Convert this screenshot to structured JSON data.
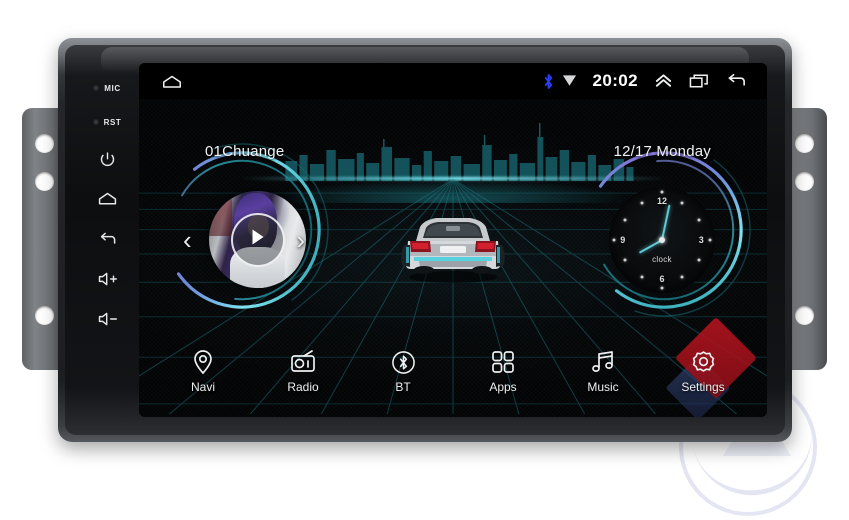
{
  "device": {
    "hard_keys": [
      {
        "name": "mic",
        "label": "MIC",
        "type": "port"
      },
      {
        "name": "reset",
        "label": "RST",
        "type": "port"
      },
      {
        "name": "power",
        "label": "",
        "type": "icon",
        "icon": "power-icon"
      },
      {
        "name": "home",
        "label": "",
        "type": "icon",
        "icon": "home-icon"
      },
      {
        "name": "back",
        "label": "",
        "type": "icon",
        "icon": "back-icon"
      },
      {
        "name": "volume-up",
        "label": "",
        "type": "icon",
        "icon": "volume-up-icon"
      },
      {
        "name": "volume-down",
        "label": "",
        "type": "icon",
        "icon": "volume-down-icon"
      }
    ]
  },
  "statusbar": {
    "home_icon": "home-icon",
    "bluetooth_icon": "bluetooth-icon",
    "bluetooth_color": "#2b3df0",
    "signal_icon": "wifi-icon",
    "clock": "20:02",
    "expand_icon": "chevron-up-icon",
    "recents_icon": "recents-icon",
    "back_icon": "back-arrow-icon"
  },
  "home": {
    "media_title": "01Chuange",
    "date_text": "12/17 Monday",
    "prev_label": "‹",
    "next_label": "›",
    "play_icon": "play-icon",
    "accent_teal": "#5fc9d6",
    "accent_purple": "#8e6fd0"
  },
  "clock_widget": {
    "word": "clock",
    "numbers": [
      "12",
      "3",
      "6",
      "9"
    ],
    "hour_value": 8,
    "minute_value": 2
  },
  "dock": [
    {
      "label": "Navi",
      "icon": "location-pin-icon"
    },
    {
      "label": "Radio",
      "icon": "radio-icon"
    },
    {
      "label": "BT",
      "icon": "bluetooth-circle-icon"
    },
    {
      "label": "Apps",
      "icon": "apps-grid-icon"
    },
    {
      "label": "Music",
      "icon": "music-note-icon"
    },
    {
      "label": "Settings",
      "icon": "gear-icon"
    }
  ]
}
